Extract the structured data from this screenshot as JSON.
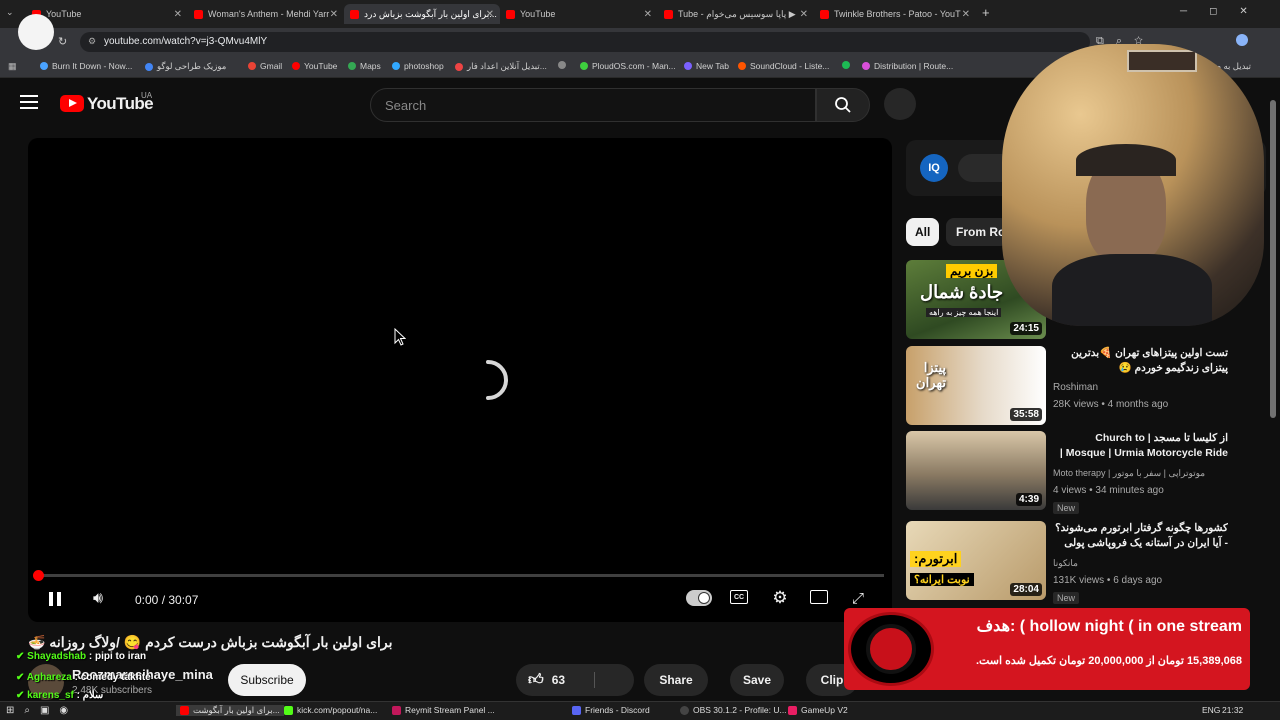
{
  "browser": {
    "tabs": [
      {
        "label": "YouTube",
        "active": false
      },
      {
        "label": "Woman's Anthem - Mehdi Yarr",
        "active": false
      },
      {
        "label": "برای اولین بار آبگوشت بزباش درد...",
        "active": true
      },
      {
        "label": "YouTube",
        "active": false
      },
      {
        "label": "Tube - پاپا سوسیس می‌خوام ▶",
        "active": false
      },
      {
        "label": "Twinkle Brothers - Patoo - YouT",
        "active": false
      }
    ],
    "new_tab_glyph": "+",
    "url": "youtube.com/watch?v=j3-QMvu4MlY",
    "bookmarks": [
      "Burn It Down - Now...",
      "موزیک طراحی لوگو",
      "Gmail",
      "YouTube",
      "Maps",
      "photoshop",
      "تبدیل آنلاین اعداد فار...",
      "",
      "PloudOS.com - Man...",
      "New Tab",
      "SoundCloud - Liste...",
      "",
      "Distribution | Route...",
      "...تبدیل به ضدا"
    ]
  },
  "youtube": {
    "logo_text": "YouTube",
    "region": "UA",
    "search_placeholder": "Search"
  },
  "player": {
    "time": "0:00 / 30:07",
    "progress": 0
  },
  "video": {
    "title": "برای اولین بار آبگوشت بزباش درست کردم 😋 /ولاگ روزانه 🍜",
    "channel": "Roozmarecihaye_mina",
    "subscribers": "2.48K subscribers",
    "subscribe_label": "Subscribe",
    "likes": "63",
    "share_label": "Share",
    "save_label": "Save",
    "clip_label": "Clip"
  },
  "chips": {
    "all": "All",
    "from": "From Roo"
  },
  "related": [
    {
      "title": "",
      "channel": "",
      "meta": "",
      "duration": "24:15",
      "badge": ""
    },
    {
      "title": "تست اولین پیتزاهای تهران 🍕بدترین پیتزای زندگیمو خوردم 😢",
      "channel": "Roshiman",
      "meta": "28K views • 4 months ago",
      "duration": "35:58",
      "badge": ""
    },
    {
      "title": "از کلیسا تا مسجد | Church to Mosque | Urmia Motorcycle Ride | ...",
      "channel": "Moto therapy | موتوتراپی | سفر با موتور",
      "meta": "4 views • 34 minutes ago",
      "duration": "4:39",
      "badge": "New"
    },
    {
      "title": "کشورها چگونه گرفتار ابرتورم می‌شوند؟ - آیا ایران در آستانه یک فروپاشی پولی است؟",
      "channel": "مانکونا",
      "meta": "131K views • 6 days ago",
      "duration": "28:04",
      "badge": "New"
    }
  ],
  "thumb_text": {
    "t1_line1": "بزن بریم",
    "t1_line2": "جادهٔ شمال",
    "t1_line3": "اینجا همه چیز به راهه",
    "t2": "پیتزا تهران",
    "t4_line1": "ابرتورم:",
    "t4_line2": "نوبت ایرانه؟"
  },
  "overlay": {
    "donation_title": "هدف: ( hollow night ( in one stream",
    "donation_progress": "15,389,068 تومان از 20,000,000 تومان تکمیل شده است."
  },
  "chat": [
    {
      "user": "Shayadshab",
      "text": "pipi to iran"
    },
    {
      "user": "Aghareza",
      "text": "comedy takhte"
    },
    {
      "user": "karens_sf",
      "text": "سلام"
    }
  ],
  "taskbar": {
    "items": [
      "برای اولین بار آبگوشت...",
      "kick.com/popout/na...",
      "Reymit Stream Panel ...",
      "Friends - Discord",
      "OBS 30.1.2 - Profile: U...",
      "GameUp V2"
    ],
    "lang": "ENG",
    "clock": "21:32"
  },
  "colors": {
    "accent": "#ff0000",
    "bg": "#0f0f0f",
    "donation_red": "#d4151f"
  }
}
